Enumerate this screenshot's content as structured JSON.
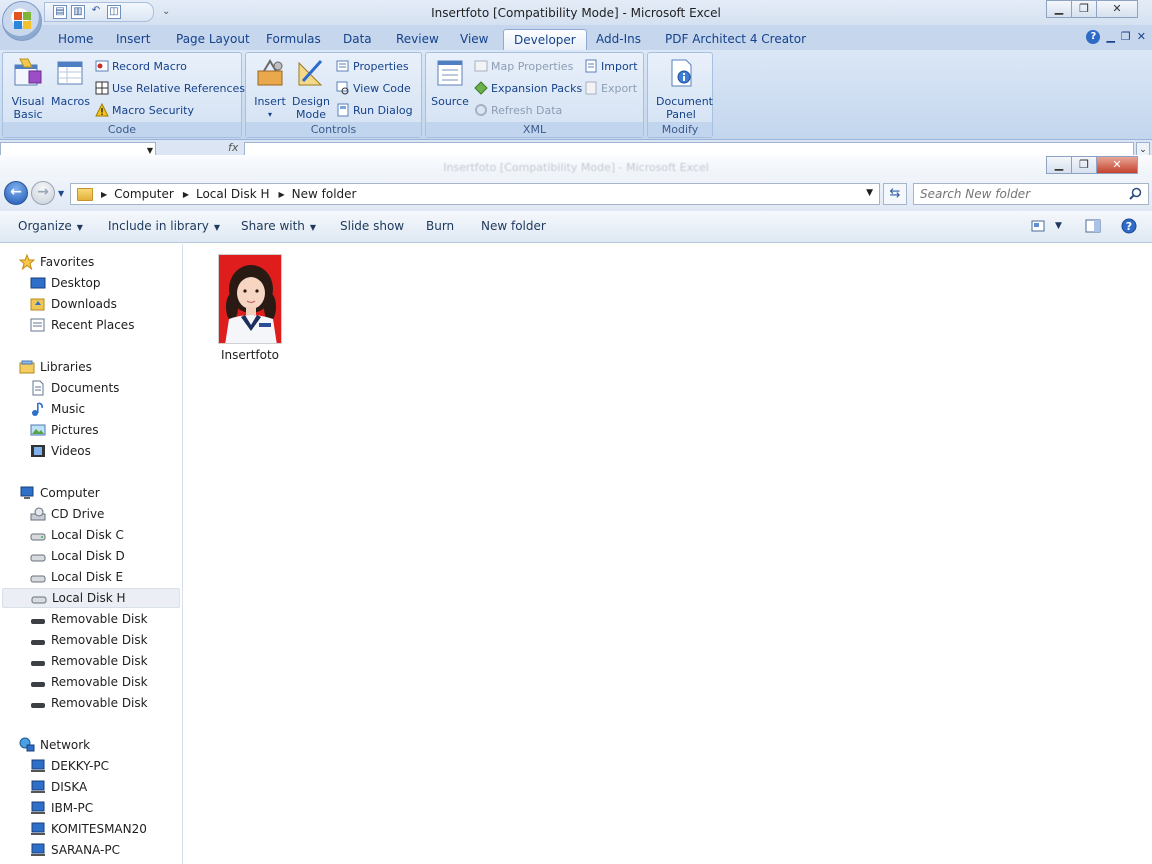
{
  "excel": {
    "title": "Insertfoto  [Compatibility Mode] - Microsoft Excel",
    "tabs": [
      "Home",
      "Insert",
      "Page Layout",
      "Formulas",
      "Data",
      "Review",
      "View",
      "Developer",
      "Add-Ins",
      "PDF Architect 4 Creator"
    ],
    "active_tab": "Developer",
    "ribbon": {
      "code": {
        "label": "Code",
        "visual_basic": "Visual Basic",
        "macros": "Macros",
        "record_macro": "Record Macro",
        "use_relative": "Use Relative References",
        "macro_security": "Macro Security"
      },
      "controls": {
        "label": "Controls",
        "insert": "Insert",
        "design_mode": "Design Mode",
        "properties": "Properties",
        "view_code": "View Code",
        "run_dialog": "Run Dialog"
      },
      "xml": {
        "label": "XML",
        "source": "Source",
        "map_properties": "Map Properties",
        "expansion_packs": "Expansion Packs",
        "refresh_data": "Refresh Data",
        "import": "Import",
        "export": "Export"
      },
      "modify": {
        "label": "Modify",
        "document_panel": "Document Panel"
      }
    },
    "formula_bar": {
      "fx": "fx"
    }
  },
  "explorer": {
    "ghost_title": "Insertfoto  [Compatibility Mode] - Microsoft Excel",
    "breadcrumb": [
      "Computer",
      "Local Disk H",
      "New folder"
    ],
    "search_placeholder": "Search New folder",
    "toolbar": {
      "organize": "Organize",
      "include_in_library": "Include in library",
      "share_with": "Share with",
      "slide_show": "Slide show",
      "burn": "Burn",
      "new_folder": "New folder"
    },
    "nav": {
      "favorites": {
        "label": "Favorites",
        "items": [
          "Desktop",
          "Downloads",
          "Recent Places"
        ]
      },
      "libraries": {
        "label": "Libraries",
        "items": [
          "Documents",
          "Music",
          "Pictures",
          "Videos"
        ]
      },
      "computer": {
        "label": "Computer",
        "items": [
          "CD Drive",
          "Local Disk C",
          "Local Disk D",
          "Local Disk E",
          "Local Disk H",
          "Removable Disk",
          "Removable Disk",
          "Removable Disk",
          "Removable Disk",
          "Removable Disk"
        ]
      },
      "network": {
        "label": "Network",
        "items": [
          "DEKKY-PC",
          "DISKA",
          "IBM-PC",
          "KOMITESMAN20",
          "SARANA-PC"
        ]
      },
      "selected": "Local Disk H"
    },
    "files": [
      {
        "name": "Insertfoto"
      }
    ]
  },
  "colors": {
    "ribbon_blue": "#c5d6ed",
    "tab_text": "#15428b",
    "thumb_bg": "#e01d1d"
  }
}
